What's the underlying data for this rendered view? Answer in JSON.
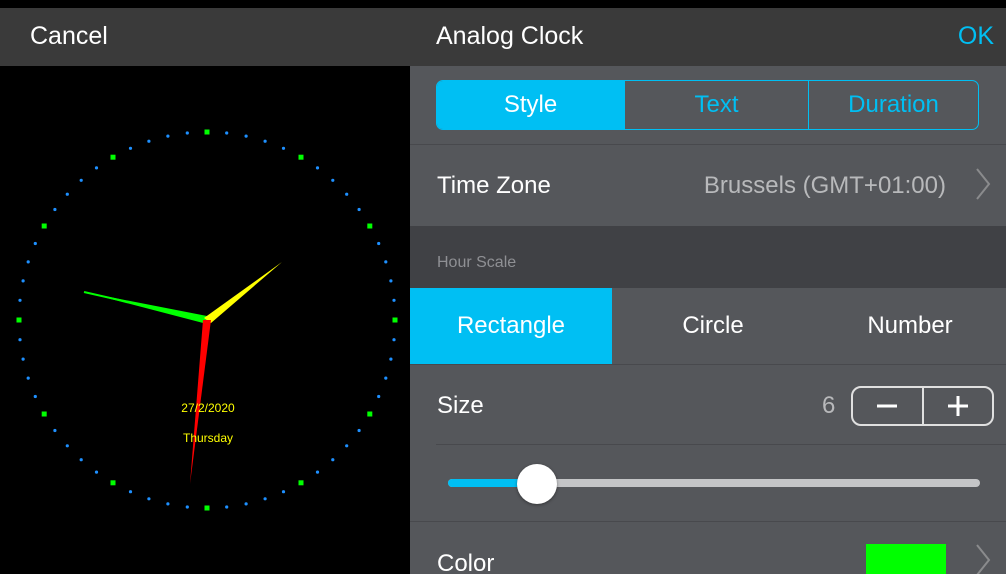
{
  "header": {
    "cancel": "Cancel",
    "title": "Analog Clock",
    "ok": "OK"
  },
  "tabs": [
    {
      "label": "Style",
      "active": true
    },
    {
      "label": "Text",
      "active": false
    },
    {
      "label": "Duration",
      "active": false
    }
  ],
  "time_zone": {
    "label": "Time Zone",
    "value": "Brussels  (GMT+01:00)"
  },
  "hour_scale": {
    "section_label": "Hour Scale",
    "options": [
      {
        "label": "Rectangle",
        "active": true
      },
      {
        "label": "Circle",
        "active": false
      },
      {
        "label": "Number",
        "active": false
      }
    ]
  },
  "size": {
    "label": "Size",
    "value": "6",
    "slider_fraction": 0.12
  },
  "color": {
    "label": "Color",
    "value": "#00ff00"
  },
  "clock": {
    "date": "27/2/2020",
    "weekday": "Thursday",
    "hour_marker_color": "#00ff00",
    "minute_marker_color": "#1e90ff",
    "hour_hand_color": "#00ff00",
    "minute_hand_color": "#ffff00",
    "second_hand_color": "#ff0000",
    "text_color": "#ffff00"
  },
  "colors": {
    "accent": "#00bff3",
    "panel_bg": "#55575b",
    "header_bg": "#3a3a3a"
  }
}
